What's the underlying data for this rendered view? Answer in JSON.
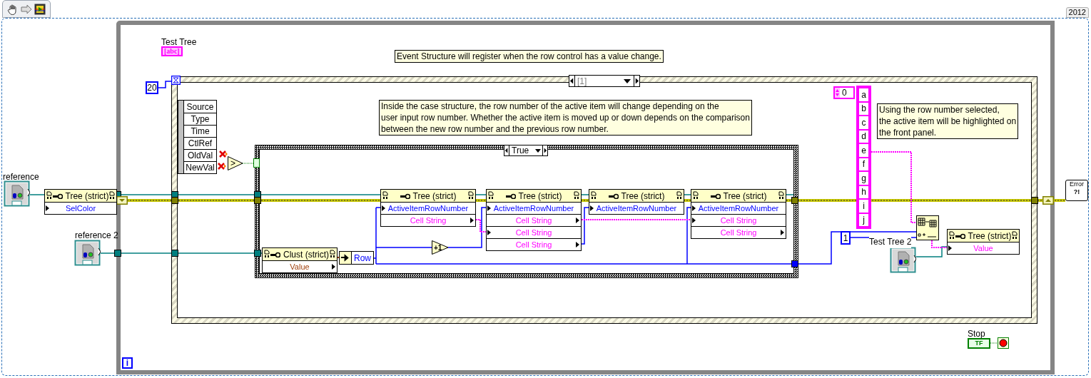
{
  "version": "2012",
  "test_tree_terminal": {
    "label": "Test Tree",
    "glyph": "[abc]"
  },
  "comments": [
    {
      "lines": [
        "Event Structure will register when the row control has a value change."
      ]
    },
    {
      "lines": [
        "Inside the case structure, the row number of the active item will change depending on the",
        "user input row number. Whether the active item is moved up or down depends on the comparison",
        "between the new row number and the previous row number."
      ]
    },
    {
      "lines": [
        "Using the row number selected,",
        "the active item will be highlighted on",
        "the front panel."
      ]
    }
  ],
  "timeout_constant": "20",
  "event_selector": "[1]",
  "event_data": [
    "Source",
    "Type",
    "Time",
    "CtlRef",
    "OldVal",
    "NewVal"
  ],
  "compare": ">",
  "case_selector": "True",
  "references": [
    {
      "label": "reference"
    },
    {
      "label": "reference 2"
    },
    {
      "label": "Test Tree 2"
    }
  ],
  "property_nodes": [
    {
      "class": "Tree (strict)",
      "properties": [
        {
          "name": "SelColor",
          "kind": "number",
          "writable": true
        }
      ]
    },
    {
      "class": "Clust (strict)",
      "properties": [
        {
          "name": "Value",
          "kind": "cluster",
          "writable": false
        }
      ]
    },
    {
      "class": "Tree (strict)",
      "properties": [
        {
          "name": "ActiveItemRowNumber",
          "kind": "number",
          "writable": true
        },
        {
          "name": "Cell String",
          "kind": "string",
          "writable": false
        }
      ]
    },
    {
      "class": "Tree (strict)",
      "properties": [
        {
          "name": "ActiveItemRowNumber",
          "kind": "number",
          "writable": true
        },
        {
          "name": "Cell String",
          "kind": "string",
          "writable": false
        },
        {
          "name": "Cell String",
          "kind": "string",
          "writable": true
        },
        {
          "name": "Cell String",
          "kind": "string",
          "writable": false
        }
      ]
    },
    {
      "class": "Tree (strict)",
      "properties": [
        {
          "name": "ActiveItemRowNumber",
          "kind": "number",
          "writable": true
        }
      ]
    },
    {
      "class": "Tree (strict)",
      "properties": [
        {
          "name": "ActiveItemRowNumber",
          "kind": "number",
          "writable": true
        },
        {
          "name": "Cell String",
          "kind": "string",
          "writable": true
        },
        {
          "name": "Cell String",
          "kind": "string",
          "writable": false
        }
      ]
    },
    {
      "class": "Tree (strict)",
      "properties": [
        {
          "name": "Value",
          "kind": "string",
          "writable": true
        }
      ]
    }
  ],
  "unbundle": "Row",
  "increment": "+1",
  "array_index": "0",
  "array": [
    "a",
    "b",
    "c",
    "d",
    "e",
    "f",
    "g",
    "h",
    "i",
    "j"
  ],
  "numeric_constant": "1",
  "error_indicator": {
    "label": "Error",
    "glyph": "?!"
  },
  "stop": {
    "label": "Stop",
    "glyph": "TF"
  },
  "loop_iteration": "i"
}
